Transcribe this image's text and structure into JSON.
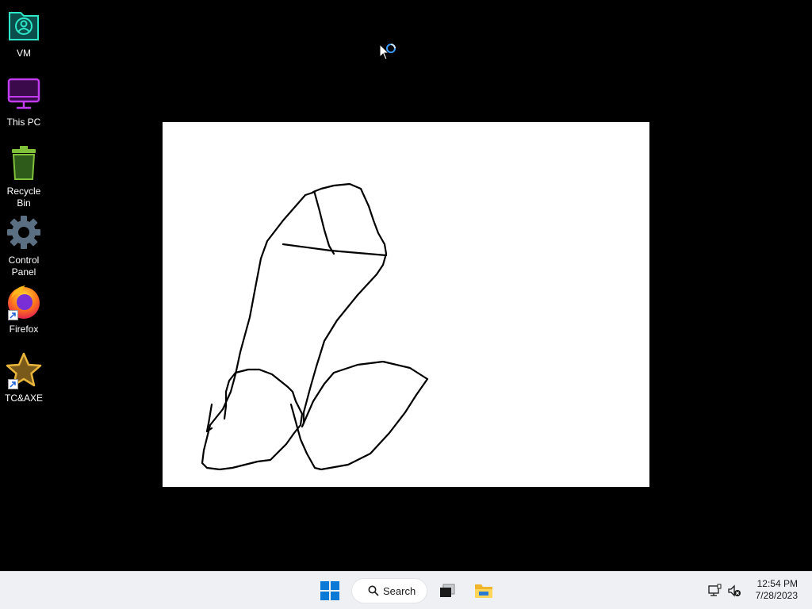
{
  "desktop": {
    "icons": [
      {
        "label": "VM",
        "icon": "vm-user-icon"
      },
      {
        "label": "This PC",
        "icon": "monitor-icon"
      },
      {
        "label": "Recycle Bin",
        "icon": "recycle-bin-icon"
      },
      {
        "label": "Control Panel",
        "icon": "gear-icon"
      },
      {
        "label": "Firefox",
        "icon": "firefox-icon"
      },
      {
        "label": "TC&AXE",
        "icon": "star-icon"
      }
    ]
  },
  "taskbar": {
    "search_label": "Search",
    "clock_time": "12:54 PM",
    "clock_date": "7/28/2023"
  },
  "colors": {
    "desktop_bg": "#000000",
    "taskbar_bg": "#eef0f4",
    "windows_blue": "#0a7ad6"
  }
}
